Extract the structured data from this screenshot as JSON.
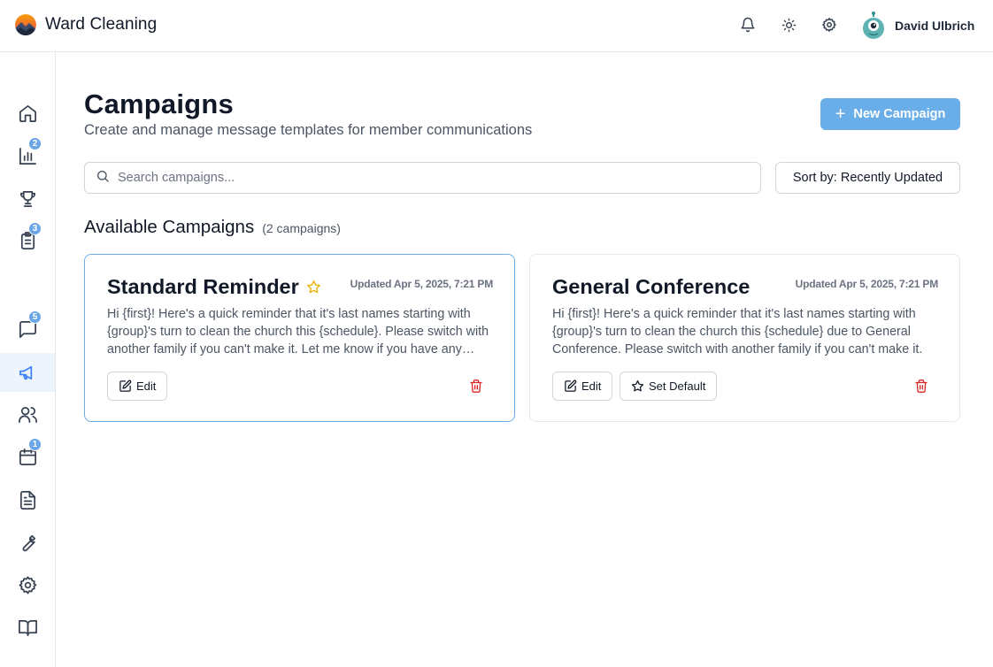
{
  "header": {
    "app_title": "Ward Cleaning",
    "user_name": "David Ulbrich",
    "icons": [
      "bell-icon",
      "sun-icon",
      "settings-icon"
    ]
  },
  "sidebar": {
    "items": [
      {
        "name": "home",
        "icon": "home-icon",
        "badge": ""
      },
      {
        "name": "reports",
        "icon": "bar-chart-icon",
        "badge": "2"
      },
      {
        "name": "trophy",
        "icon": "trophy-icon",
        "badge": ""
      },
      {
        "name": "tasks",
        "icon": "clipboard-list-icon",
        "badge": "3"
      },
      {
        "name": "messages",
        "icon": "message-icon",
        "badge": "5"
      },
      {
        "name": "campaigns",
        "icon": "megaphone-icon",
        "badge": "",
        "active": true
      },
      {
        "name": "members",
        "icon": "users-icon",
        "badge": ""
      },
      {
        "name": "calendar",
        "icon": "calendar-icon",
        "badge": "1"
      },
      {
        "name": "documents",
        "icon": "file-text-icon",
        "badge": ""
      },
      {
        "name": "tools",
        "icon": "wrench-icon",
        "badge": ""
      },
      {
        "name": "settings",
        "icon": "gear-icon",
        "badge": ""
      },
      {
        "name": "guide",
        "icon": "book-icon",
        "badge": ""
      }
    ]
  },
  "main": {
    "title": "Campaigns",
    "subtitle": "Create and manage message templates for member communications",
    "new_button_label": "New Campaign",
    "search_placeholder": "Search campaigns...",
    "sort_label": "Sort by: Recently Updated",
    "section_title": "Available Campaigns",
    "section_count": "(2 campaigns)",
    "cards": [
      {
        "title": "Standard Reminder",
        "is_default": true,
        "updated": "Updated Apr 5, 2025, 7:21 PM",
        "body": "Hi {first}! Here's a quick reminder that it's last names starting with {group}'s turn to clean the church this {schedule}. Please switch with another family if you can't make it. Let me know if you have any questions!",
        "edit_label": "Edit"
      },
      {
        "title": "General Conference",
        "is_default": false,
        "updated": "Updated Apr 5, 2025, 7:21 PM",
        "body": "Hi {first}! Here's a quick reminder that it's last names starting with {group}'s turn to clean the church this {schedule} due to General Conference. Please switch with another family if you can't make it.",
        "edit_label": "Edit",
        "set_default_label": "Set Default"
      }
    ]
  },
  "colors": {
    "accent": "#6aaee9",
    "badge": "#6aa5e6",
    "active_nav_bg": "#eef4fc",
    "danger": "#dc2626",
    "star": "#eab308"
  }
}
